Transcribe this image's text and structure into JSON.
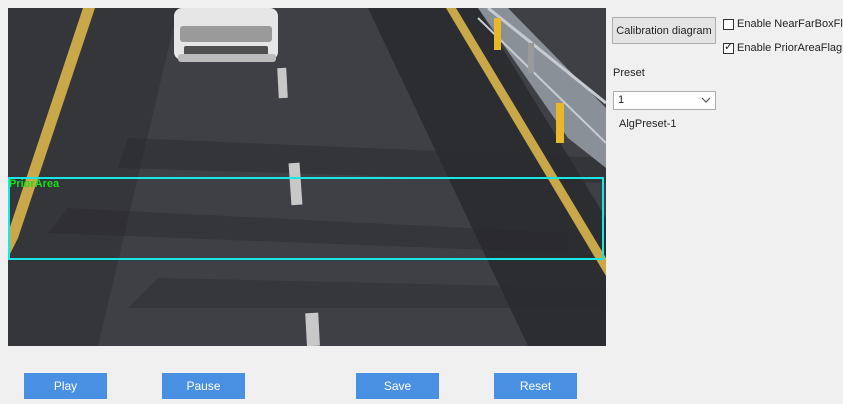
{
  "video": {
    "prior_area_label": "PriorArea",
    "prior_area_color": "#19e6e6",
    "prior_label_color": "#18e018"
  },
  "controls": {
    "calibration_label": "Calibration diagram",
    "near_far_label": "Enable NearFarBoxFlag",
    "near_far_checked": false,
    "prior_area_flag_label": "Enable PriorAreaFlag",
    "prior_area_flag_checked": true,
    "preset_label": "Preset",
    "preset_value": "1",
    "alg_preset_name": "AlgPreset-1"
  },
  "buttons": {
    "play": "Play",
    "pause": "Pause",
    "save": "Save",
    "reset": "Reset",
    "color": "#4a90e2"
  }
}
